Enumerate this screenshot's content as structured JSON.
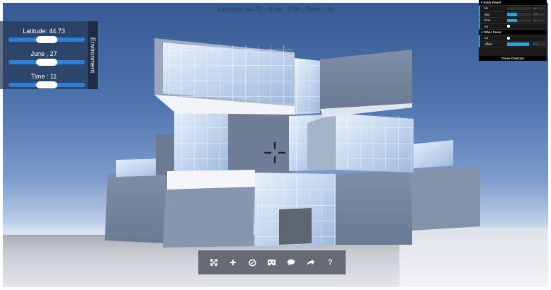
{
  "status": {
    "text": "Latitude: 44.73 , June , 27th , Time : 11"
  },
  "environment": {
    "tab_label": "Environment",
    "latitude_label": "Latitude: 44.73",
    "date_label": "June , 27",
    "time_label": "Time : 11",
    "latitude_level": 0.5,
    "date_level": 0.5,
    "time_level": 0.5
  },
  "controls": {
    "solar_panel_title": "▾ Solar Panel",
    "rows": [
      {
        "name": "lat",
        "value": "44",
        "level": 0.0
      },
      {
        "name": "day",
        "value": "178",
        "level": 0.4
      },
      {
        "name": "time",
        "value": "11",
        "level": 0.4
      }
    ],
    "on_label": "on",
    "other_panel_title": "▾ Other Panel",
    "on2_label": "on",
    "offset_label": "offset",
    "offset_value": "0.9",
    "offset_level": 0.9,
    "close_label": "Close Controls"
  },
  "toolbar": {
    "icons": [
      "fullscreen-icon",
      "add-icon",
      "compass-icon",
      "vr-icon",
      "comment-icon",
      "share-icon",
      "help-icon"
    ],
    "help_label": "?"
  },
  "colors": {
    "slider_blue": "#2f7fd6",
    "gui_accent": "#2fa1d6",
    "panel_bg": "#263856"
  }
}
